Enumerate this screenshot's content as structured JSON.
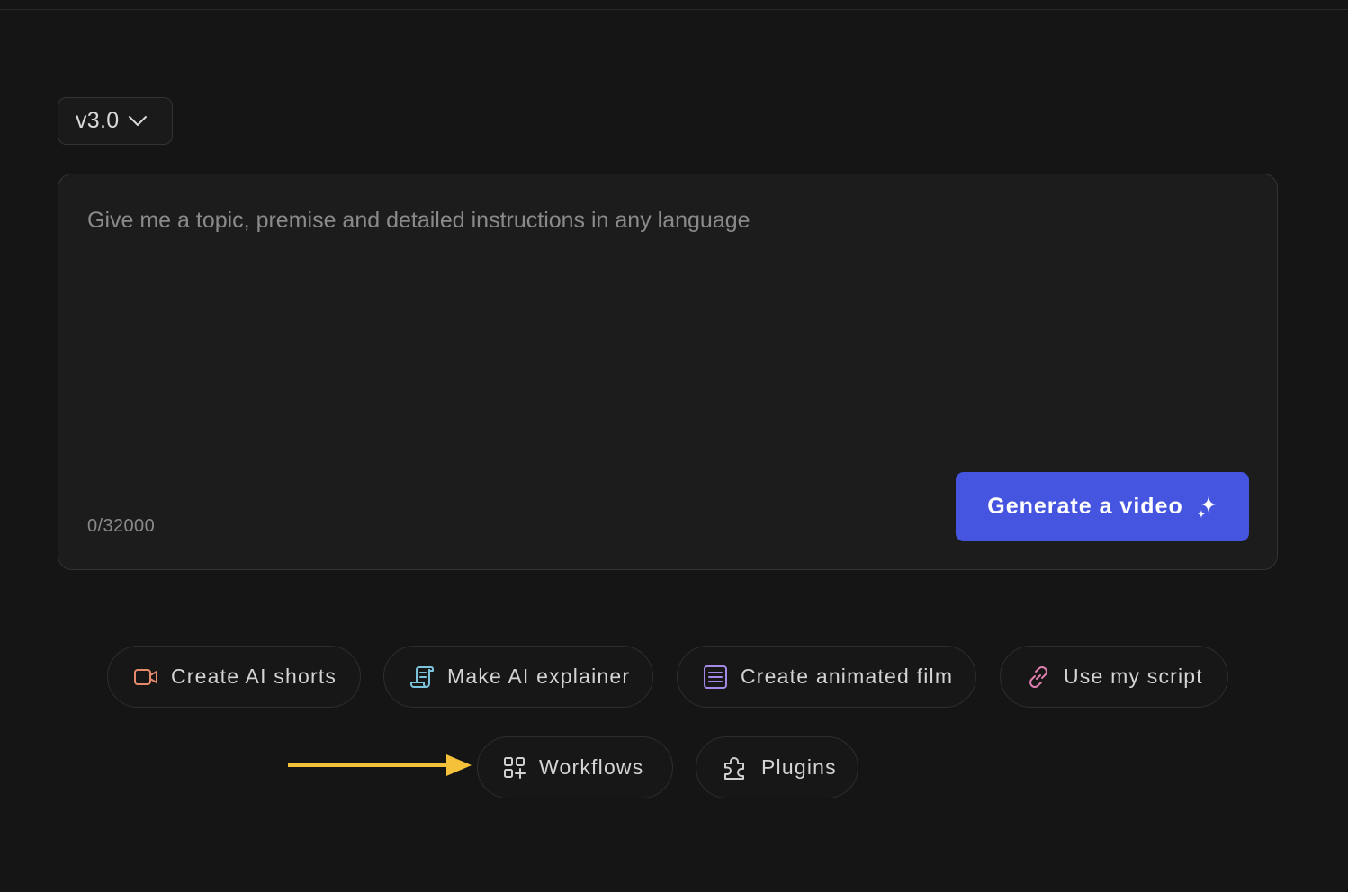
{
  "version_select": {
    "value": "v3.0",
    "icon": "chevron-down-icon"
  },
  "prompt": {
    "placeholder": "Give me a topic, premise and detailed instructions in any language",
    "value": "",
    "char_count": "0/32000"
  },
  "generate_button": {
    "label": "Generate a video",
    "icon": "sparkle-icon",
    "color": "#4655e0"
  },
  "quick_actions": [
    {
      "label": "Create AI shorts",
      "icon": "video-camera-icon",
      "icon_color": "#e48a6a"
    },
    {
      "label": "Make AI explainer",
      "icon": "scroll-icon",
      "icon_color": "#7cc4dc"
    },
    {
      "label": "Create animated film",
      "icon": "document-lines-icon",
      "icon_color": "#a48ae6"
    },
    {
      "label": "Use my script",
      "icon": "link-icon",
      "icon_color": "#e07fb0"
    },
    {
      "label": "Workflows",
      "icon": "grid-plus-icon",
      "icon_color": "#cfcfcf"
    },
    {
      "label": "Plugins",
      "icon": "puzzle-icon",
      "icon_color": "#cfcfcf"
    }
  ],
  "annotation": {
    "arrow_color": "#f5c13a"
  }
}
